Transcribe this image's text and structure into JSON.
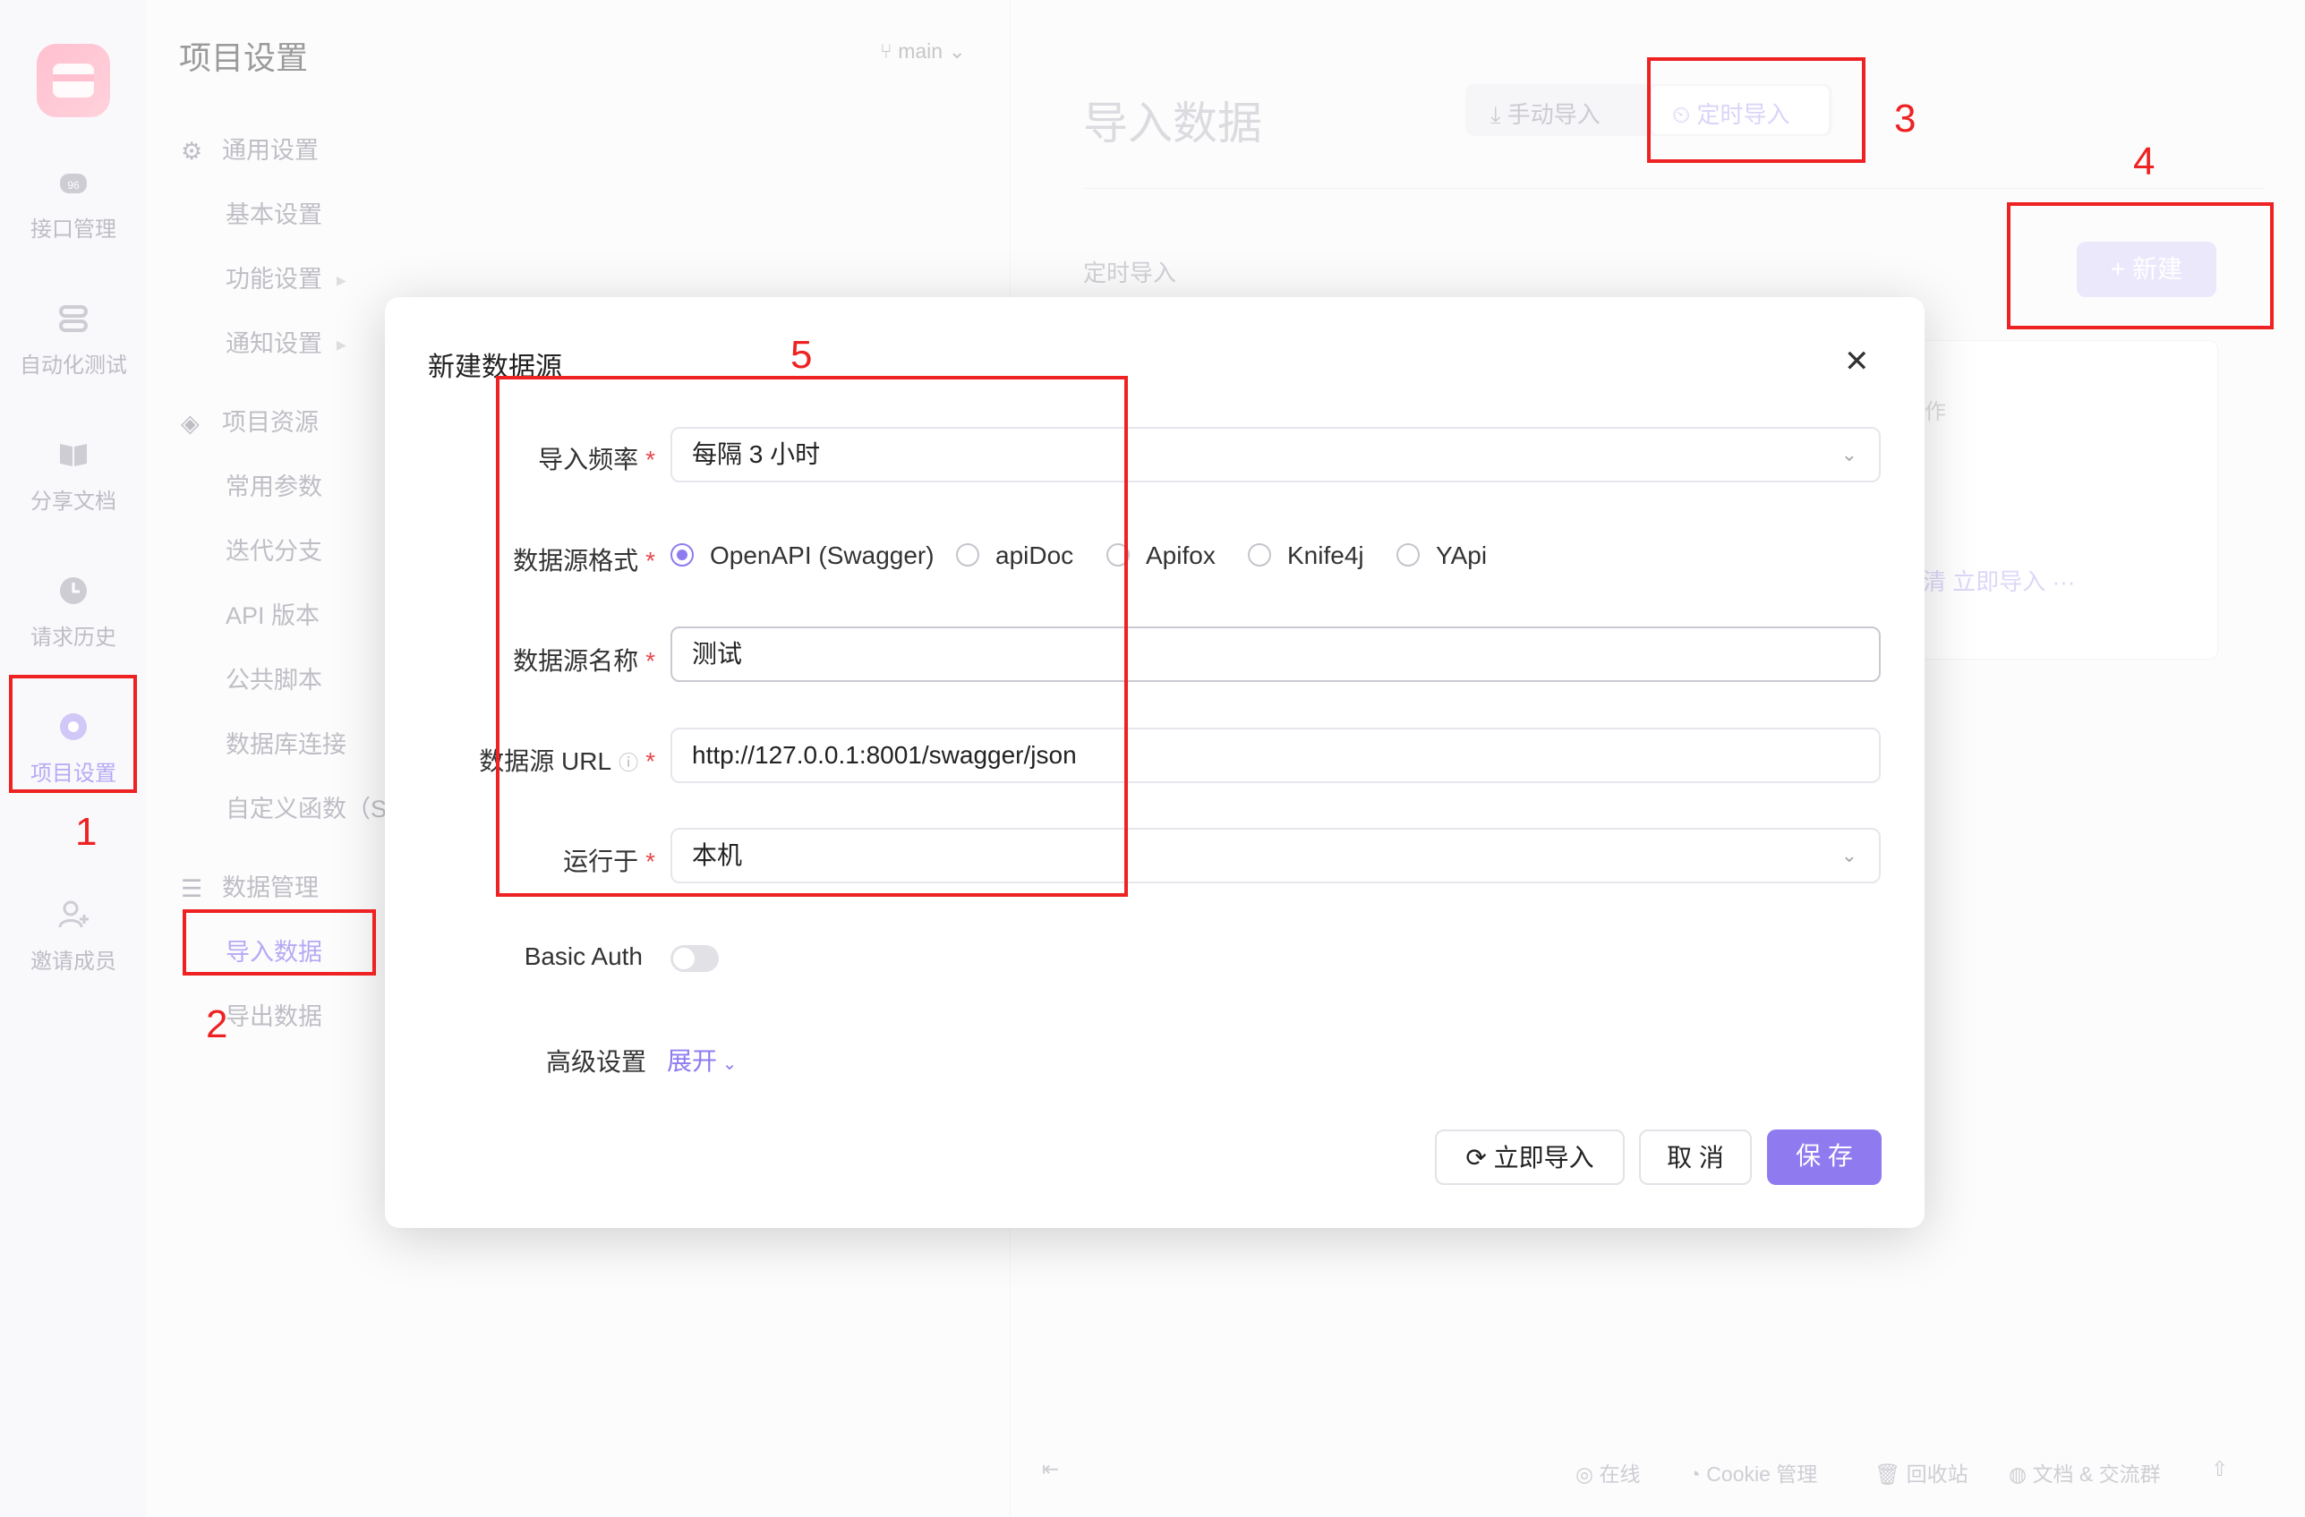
{
  "rail": {
    "items": [
      {
        "label": "接口管理"
      },
      {
        "label": "自动化测试"
      },
      {
        "label": "分享文档"
      },
      {
        "label": "请求历史"
      },
      {
        "label": "项目设置"
      },
      {
        "label": "邀请成员"
      }
    ]
  },
  "menu": {
    "title": "项目设置",
    "branch": "main",
    "groups": [
      {
        "label": "通用设置",
        "items": [
          "基本设置",
          "功能设置",
          "通知设置"
        ]
      },
      {
        "label": "项目资源",
        "items": [
          "常用参数",
          "迭代分支",
          "API 版本",
          "公共脚本",
          "数据库连接",
          "自定义函数（S"
        ]
      },
      {
        "label": "数据管理",
        "items": [
          "导入数据",
          "导出数据"
        ]
      }
    ]
  },
  "main": {
    "title": "导入数据",
    "tabs": [
      "手动导入",
      "定时导入"
    ],
    "section_label": "定时导入",
    "new_button": "+ 新建",
    "bg_text_action": "作",
    "bg_text_links": "清  立即导入  ···"
  },
  "footer": {
    "online": "在线",
    "cookie": "Cookie 管理",
    "recycle": "回收站",
    "docs": "文档 & 交流群"
  },
  "modal": {
    "title": "新建数据源",
    "freq_label": "导入频率",
    "freq_value": "每隔 3 小时",
    "format_label": "数据源格式",
    "formats": [
      "OpenAPI (Swagger)",
      "apiDoc",
      "Apifox",
      "Knife4j",
      "YApi"
    ],
    "name_label": "数据源名称",
    "name_value": "测试",
    "url_label": "数据源 URL",
    "url_value": "http://127.0.0.1:8001/swagger/json",
    "run_label": "运行于",
    "run_value": "本机",
    "auth_label": "Basic Auth",
    "advanced_label": "高级设置",
    "expand_link": "展开",
    "btn_import": "立即导入",
    "btn_cancel": "取 消",
    "btn_save": "保 存",
    "required_mark": "*"
  },
  "annotations": [
    "1",
    "2",
    "3",
    "4",
    "5"
  ],
  "colors": {
    "accent": "#8f7bef",
    "annotation": "#ee2222"
  }
}
